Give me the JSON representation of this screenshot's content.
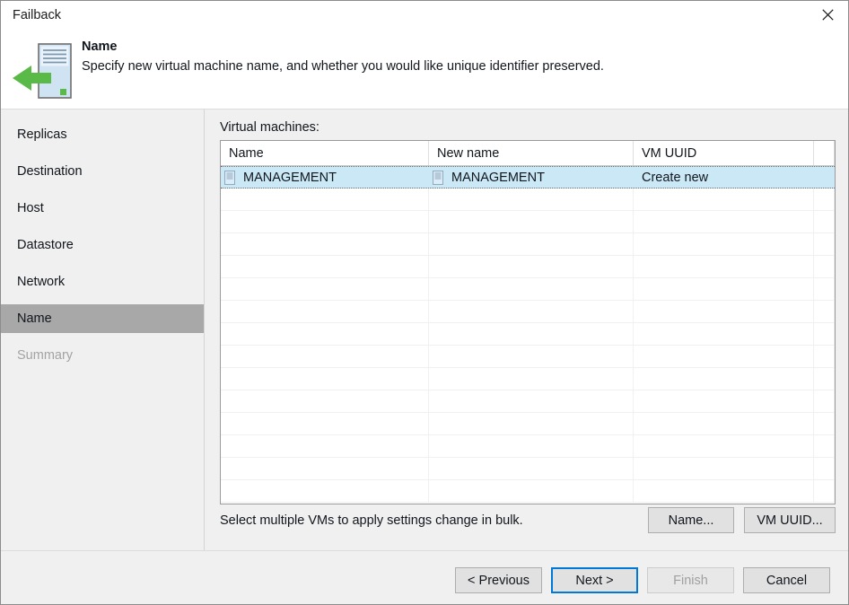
{
  "window": {
    "title": "Failback",
    "close_icon": "close-icon"
  },
  "header": {
    "icon": "server-failback-icon",
    "title": "Name",
    "subtitle": "Specify new virtual machine name, and whether you would like unique identifier preserved."
  },
  "sidebar": {
    "items": [
      {
        "label": "Replicas",
        "state": "normal"
      },
      {
        "label": "Destination",
        "state": "normal"
      },
      {
        "label": "Host",
        "state": "normal"
      },
      {
        "label": "Datastore",
        "state": "normal"
      },
      {
        "label": "Network",
        "state": "normal"
      },
      {
        "label": "Name",
        "state": "selected"
      },
      {
        "label": "Summary",
        "state": "disabled"
      }
    ]
  },
  "main": {
    "list_label": "Virtual machines:",
    "columns": [
      "Name",
      "New name",
      "VM UUID",
      ""
    ],
    "rows": [
      {
        "selected": true,
        "name": "MANAGEMENT",
        "name_icon": "vm-icon",
        "new_name": "MANAGEMENT",
        "new_name_icon": "vm-icon",
        "vm_uuid": "Create new",
        "extra": ""
      }
    ],
    "empty_row_count": 14,
    "bulk_hint": "Select multiple VMs to apply settings change in bulk.",
    "name_button": "Name...",
    "uuid_button": "VM UUID..."
  },
  "footer": {
    "previous": "< Previous",
    "next": "Next >",
    "finish": "Finish",
    "cancel": "Cancel"
  },
  "colors": {
    "selection_blue": "#cbe8f6",
    "sidebar_selected": "#a8a8a8",
    "focus_border": "#0078d7",
    "panel": "#f0f0f0",
    "accent_green": "#5aba47"
  }
}
